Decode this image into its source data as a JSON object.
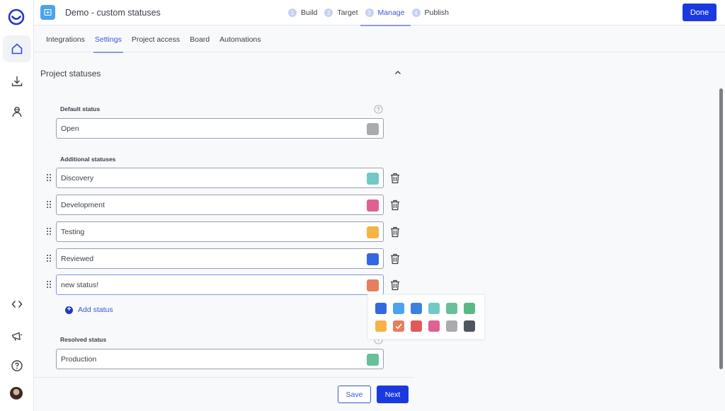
{
  "app": {
    "title": "Demo - custom statuses"
  },
  "steps": [
    {
      "num": "1",
      "label": "Build",
      "active": false
    },
    {
      "num": "2",
      "label": "Target",
      "active": false
    },
    {
      "num": "3",
      "label": "Manage",
      "active": true
    },
    {
      "num": "4",
      "label": "Publish",
      "active": false
    }
  ],
  "header": {
    "done_label": "Done"
  },
  "tabs": [
    {
      "label": "Integrations",
      "active": false
    },
    {
      "label": "Settings",
      "active": true
    },
    {
      "label": "Project access",
      "active": false
    },
    {
      "label": "Board",
      "active": false
    },
    {
      "label": "Automations",
      "active": false
    }
  ],
  "sidebar": {
    "icons": [
      "logo-icon",
      "home-icon",
      "download-icon",
      "user-icon",
      "code-icon",
      "megaphone-icon",
      "help-icon",
      "avatar"
    ]
  },
  "section": {
    "title": "Project statuses",
    "default_label": "Default status",
    "default_status": {
      "value": "Open",
      "color": "#a9abae"
    },
    "additional_label": "Additional statuses",
    "additional_statuses": [
      {
        "value": "Discovery",
        "color": "#72c9c3"
      },
      {
        "value": "Development",
        "color": "#e06094"
      },
      {
        "value": "Testing",
        "color": "#f5b446"
      },
      {
        "value": "Reviewed",
        "color": "#3467e0"
      },
      {
        "value": "new status!",
        "color": "#e57f5e",
        "focused": true
      }
    ],
    "add_status_label": "Add status",
    "resolved_label": "Resolved status",
    "resolved_status": {
      "value": "Production",
      "color": "#68c09a"
    }
  },
  "color_picker": {
    "selected": "#e57f5e",
    "colors": [
      "#3467e0",
      "#4aa3ec",
      "#3b82e0",
      "#72c9c3",
      "#68c09a",
      "#59b983",
      "#f5b446",
      "#e57f5e",
      "#e05a5a",
      "#e06094",
      "#a9abae",
      "#4f5660"
    ]
  },
  "footer": {
    "save_label": "Save",
    "next_label": "Next"
  }
}
